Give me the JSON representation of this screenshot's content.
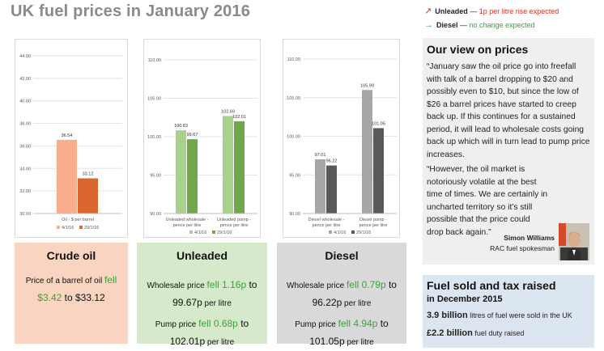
{
  "page": {
    "title": "UK fuel prices in January 2016"
  },
  "key": {
    "unleaded": {
      "name": "Unleaded",
      "sep": " — ",
      "note": "1p per litre rise expected",
      "color": "#d9352b"
    },
    "diesel": {
      "name": "Diesel",
      "sep": " — ",
      "note": "no change expected",
      "color": "#3aa33a"
    }
  },
  "legend": {
    "d1": "4/1/16",
    "d2": "29/1/16"
  },
  "chart_data": [
    {
      "type": "bar",
      "categories": [
        "Oil - $ per barrel"
      ],
      "series": [
        {
          "name": "4/1/16",
          "values": [
            36.54
          ],
          "color": "#f8ae8c"
        },
        {
          "name": "29/1/16",
          "values": [
            33.12
          ],
          "color": "#d9662c"
        }
      ],
      "ylim": [
        30,
        44
      ],
      "yticks": [
        "30.00",
        "32.00",
        "34.00",
        "36.00",
        "38.00",
        "40.00",
        "42.00",
        "44.00"
      ],
      "data_labels": [
        [
          "36.54"
        ],
        [
          "33.12"
        ]
      ],
      "legend_position": "bottom"
    },
    {
      "type": "bar",
      "categories": [
        "Unleaded wholesale - pence per litre",
        "Unleaded pump - pence per litre"
      ],
      "series": [
        {
          "name": "4/1/16",
          "values": [
            100.83,
            102.69
          ],
          "color": "#a9d18e"
        },
        {
          "name": "29/1/16",
          "values": [
            99.67,
            102.01
          ],
          "color": "#70a74a"
        }
      ],
      "ylim": [
        90,
        110
      ],
      "yticks": [
        "90.00",
        "95.00",
        "100.00",
        "105.00",
        "110.00"
      ],
      "data_labels": [
        [
          "100.83",
          "102.69"
        ],
        [
          "99.67",
          "102.01"
        ]
      ],
      "legend_position": "bottom"
    },
    {
      "type": "bar",
      "categories": [
        "Diesel wholesale - pence per litre",
        "Diesel pump - pence per litre"
      ],
      "series": [
        {
          "name": "4/1/16",
          "values": [
            97.01,
            105.99
          ],
          "color": "#a6a6a6"
        },
        {
          "name": "29/1/16",
          "values": [
            96.22,
            101.05
          ],
          "color": "#595959"
        }
      ],
      "ylim": [
        90,
        110
      ],
      "yticks": [
        "90.00",
        "95.00",
        "100.00",
        "105.00",
        "110.00"
      ],
      "data_labels": [
        [
          "97.01",
          "105.99"
        ],
        [
          "96.22",
          "101.05"
        ]
      ],
      "legend_position": "bottom"
    }
  ],
  "cards": {
    "crude": {
      "title": "Crude oil",
      "bg": "#f9d5c1",
      "l1a": "Price of a barrel of oil ",
      "l1b": "fell",
      "l2a": "$3.42",
      "l2b": " to $33.12"
    },
    "unleaded": {
      "title": "Unleaded",
      "bg": "#d7e9cb",
      "w1": "Wholesale price ",
      "w2": "fell 1.16p",
      "w3": " to",
      "w4": "99.67p",
      "w5": " per litre",
      "p1": "Pump price ",
      "p2": "fell 0.68p",
      "p3": " to",
      "p4": "102.01p",
      "p5": " per litre"
    },
    "diesel": {
      "title": "Diesel",
      "bg": "#d9d9d9",
      "w1": "Wholesale price ",
      "w2": "fell 0.79p",
      "w3": " to",
      "w4": "96.22p",
      "w5": " per litre",
      "p1": "Pump price ",
      "p2": "fell 4.94p",
      "p3": " to",
      "p4": "101.05p",
      "p5": " per litre"
    }
  },
  "view": {
    "title": "Our view on prices",
    "p1": "“January saw the oil price go into freefall with talk of a barrel dropping to $20 and possibly even to $10, but since the low of $26 a barrel prices have started to creep back up. If this continues for a sustained period, it will lead to wholesale costs going back up which will in turn lead to pump price increases.",
    "p2": "“However, the oil market is notoriously volatile at the best time of times. We are certainly in uncharted territory so it’s still possible that the price could drop back again.”",
    "name": "Simon Williams",
    "role": "RAC fuel spokesman"
  },
  "fuel": {
    "title": "Fuel sold and tax raised",
    "subtitle": "in December 2015",
    "stat1_value": "3.9 billion",
    "stat1_text": " litres of fuel were sold in the UK",
    "stat2_value": "£2.2 billion",
    "stat2_text": " fuel duty raised"
  }
}
